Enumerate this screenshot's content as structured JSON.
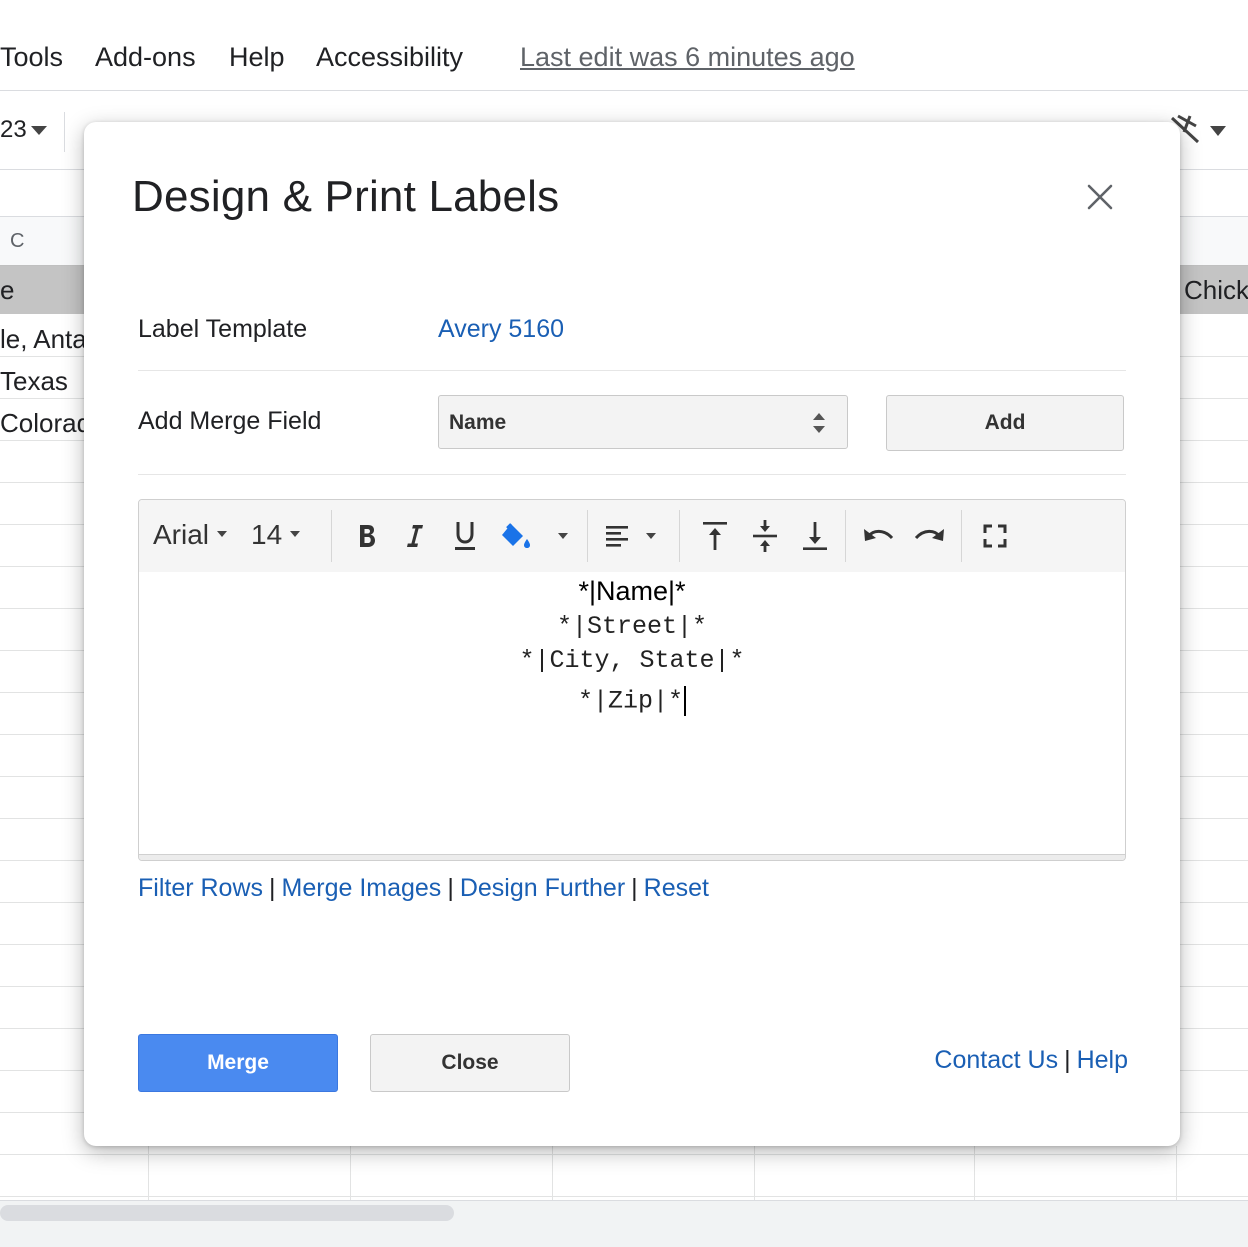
{
  "app": {
    "menu": [
      "Tools",
      "Add-ons",
      "Help",
      "Accessibility"
    ],
    "last_edit": "Last edit was 6 minutes ago",
    "zoom_fragment": "23"
  },
  "sheet": {
    "column_header": "C",
    "header_left_fragment": "e",
    "header_right_fragment": "Chick",
    "rows": [
      "le, Anta",
      " Texas",
      "Colorad"
    ]
  },
  "dialog": {
    "title": "Design & Print Labels",
    "label_template_label": "Label Template",
    "label_template_value": "Avery 5160",
    "merge_field_label": "Add Merge Field",
    "merge_field_selected": "Name",
    "add_label": "Add",
    "editor": {
      "font": "Arial",
      "font_size": "14",
      "lines": [
        "*|Name|*",
        "*|Street|*",
        "*|City, State|*",
        "*|Zip|*"
      ]
    },
    "links": [
      "Filter Rows",
      "Merge Images",
      "Design Further",
      "Reset"
    ],
    "merge_label": "Merge",
    "close_label": "Close",
    "footer_links": [
      "Contact Us",
      "Help"
    ]
  },
  "colors": {
    "link": "#1a5fb4",
    "primary_button": "#4a8af0"
  }
}
